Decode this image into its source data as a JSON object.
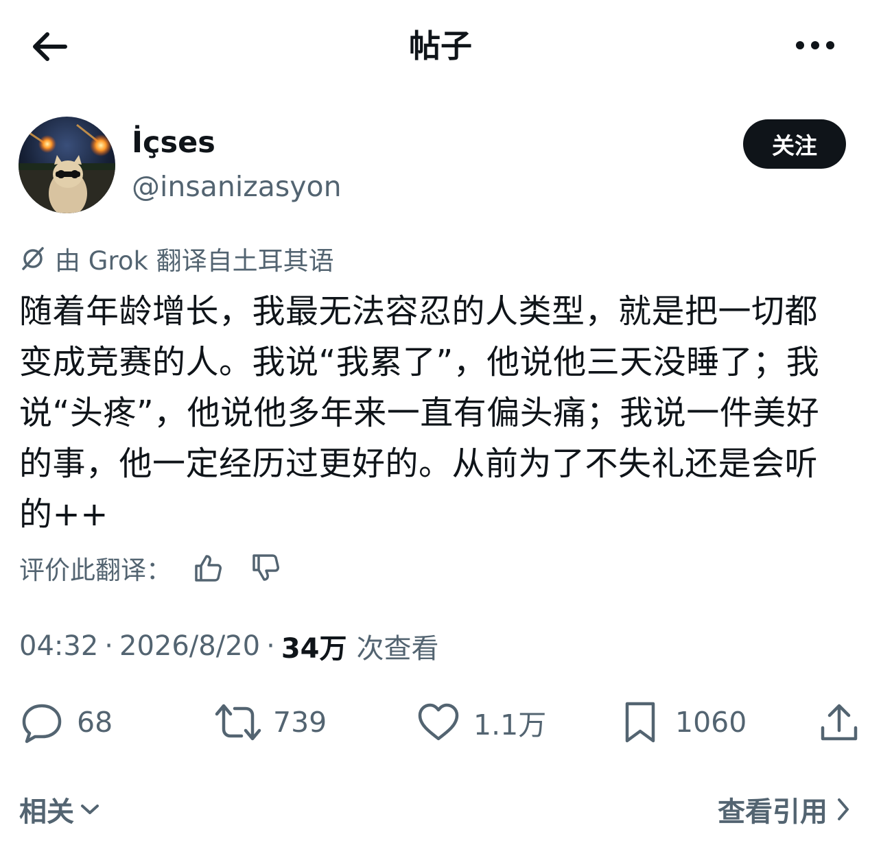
{
  "header": {
    "title": "帖子"
  },
  "author": {
    "display_name": "İçses",
    "handle": "@insanizasyon",
    "follow_label": "关注"
  },
  "translation": {
    "note": "由 Grok 翻译自土耳其语",
    "rate_label": "评价此翻译："
  },
  "tweet": {
    "text": "随着年龄增长，我最无法容忍的人类型，就是把一切都变成竞赛的人。我说“我累了”，他说他三天没睡了；我说“头疼”，他说他多年来一直有偏头痛；我说一件美好的事，他一定经历过更好的。从前为了不失礼还是会听的++"
  },
  "meta": {
    "time": "04:32",
    "separator": "·",
    "date": "2026/8/20",
    "views_count": "34万",
    "views_label": "次查看"
  },
  "actions": {
    "replies": "68",
    "reposts": "739",
    "likes": "1.1万",
    "bookmarks": "1060"
  },
  "footer": {
    "related_label": "相关",
    "quotes_label": "查看引用"
  },
  "icons": {
    "back": "arrow-left-icon",
    "more": "more-horizontal-icon",
    "grok": "grok-icon",
    "thumbs_up": "thumbs-up-icon",
    "thumbs_down": "thumbs-down-icon",
    "reply": "reply-icon",
    "repost": "repost-icon",
    "like": "heart-icon",
    "bookmark": "bookmark-icon",
    "share": "share-icon",
    "chevron_down": "chevron-down-icon",
    "chevron_right": "chevron-right-icon"
  },
  "colors": {
    "text_primary": "#0f1419",
    "text_secondary": "#536471",
    "follow_bg": "#0f1419",
    "follow_text": "#ffffff"
  }
}
